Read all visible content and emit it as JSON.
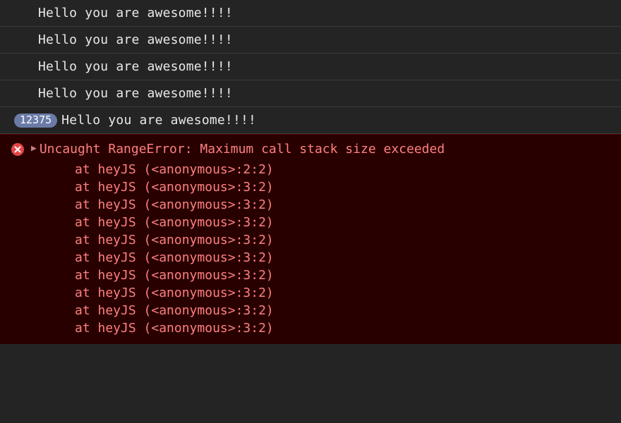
{
  "logs": [
    {
      "count": null,
      "text": "Hello you are awesome!!!!"
    },
    {
      "count": null,
      "text": "Hello you are awesome!!!!"
    },
    {
      "count": null,
      "text": "Hello you are awesome!!!!"
    },
    {
      "count": null,
      "text": "Hello you are awesome!!!!"
    },
    {
      "count": "12375",
      "text": "Hello you are awesome!!!!"
    }
  ],
  "error": {
    "message": "Uncaught RangeError: Maximum call stack size exceeded",
    "stack": [
      "at heyJS (<anonymous>:2:2)",
      "at heyJS (<anonymous>:3:2)",
      "at heyJS (<anonymous>:3:2)",
      "at heyJS (<anonymous>:3:2)",
      "at heyJS (<anonymous>:3:2)",
      "at heyJS (<anonymous>:3:2)",
      "at heyJS (<anonymous>:3:2)",
      "at heyJS (<anonymous>:3:2)",
      "at heyJS (<anonymous>:3:2)",
      "at heyJS (<anonymous>:3:2)"
    ]
  },
  "colors": {
    "background": "#242424",
    "log_text": "#e8e8e8",
    "badge_bg": "#6b7ba8",
    "error_bg": "#290000",
    "error_text": "#ff8080",
    "error_icon_bg": "#e24646"
  }
}
